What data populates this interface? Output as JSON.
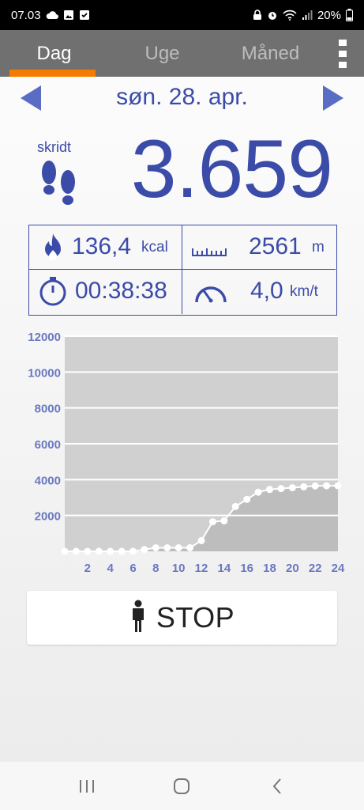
{
  "status_bar": {
    "time": "07.03",
    "battery": "20%"
  },
  "tabs": [
    {
      "label": "Dag",
      "active": true
    },
    {
      "label": "Uge",
      "active": false
    },
    {
      "label": "Måned",
      "active": false
    }
  ],
  "date": {
    "label": "søn. 28. apr."
  },
  "steps": {
    "label": "skridt",
    "value": "3.659"
  },
  "stats": {
    "calories": {
      "value": "136,4",
      "unit": "kcal",
      "icon": "flame-icon"
    },
    "distance": {
      "value": "2561",
      "unit": "m",
      "icon": "ruler-icon"
    },
    "duration": {
      "value": "00:38:38",
      "unit": "",
      "icon": "stopwatch-icon"
    },
    "speed": {
      "value": "4,0",
      "unit": "km/t",
      "icon": "speedometer-icon"
    }
  },
  "stop_button": {
    "label": "STOP",
    "icon": "person-icon"
  },
  "colors": {
    "accent": "#3b4ba8",
    "tab_indicator": "#f57c00",
    "tabbar": "#707070",
    "chart_bg": "#d0d0d0",
    "chart_fill": "#bdbdbd"
  },
  "chart_data": {
    "type": "area",
    "x": [
      0,
      1,
      2,
      3,
      4,
      5,
      6,
      7,
      8,
      9,
      10,
      11,
      12,
      13,
      14,
      15,
      16,
      17,
      18,
      19,
      20,
      21,
      22,
      23,
      24
    ],
    "values": [
      0,
      0,
      0,
      0,
      0,
      0,
      0,
      100,
      200,
      200,
      200,
      200,
      600,
      1650,
      1700,
      2500,
      2900,
      3300,
      3450,
      3500,
      3550,
      3600,
      3650,
      3659,
      3659
    ],
    "yticks": [
      "2000",
      "4000",
      "6000",
      "8000",
      "10000",
      "12000"
    ],
    "xticks": [
      "2",
      "4",
      "6",
      "8",
      "10",
      "12",
      "14",
      "16",
      "18",
      "20",
      "22",
      "24"
    ],
    "ylim": [
      0,
      12000
    ],
    "xlim": [
      0,
      24
    ],
    "grid": true,
    "legend": "none"
  }
}
